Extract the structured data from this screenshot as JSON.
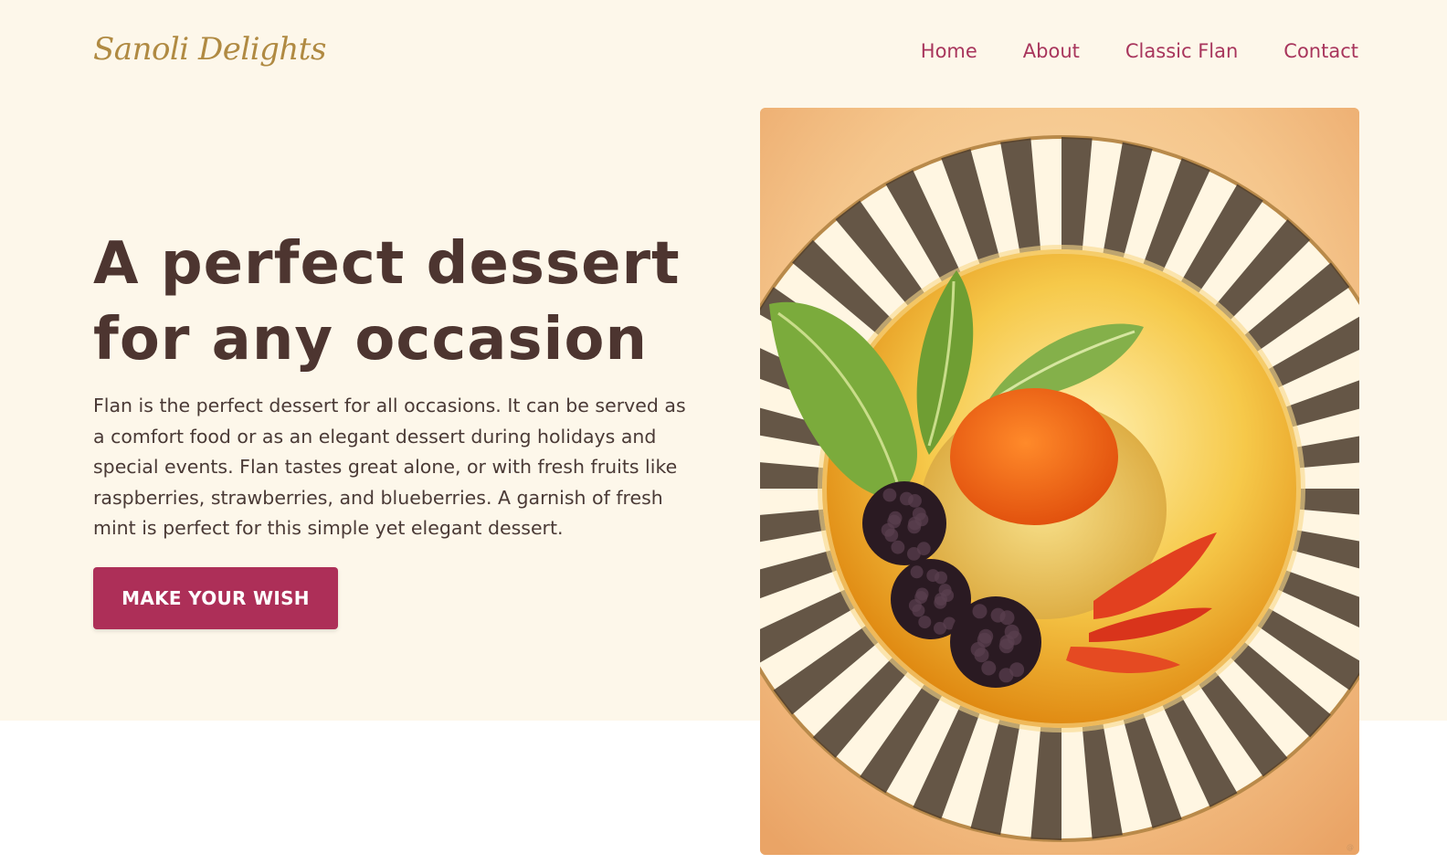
{
  "brand": {
    "logo_text": "Sanoli Delights"
  },
  "nav": {
    "items": [
      "Home",
      "About",
      "Classic Flan",
      "Contact"
    ]
  },
  "hero": {
    "headline_line1": "A perfect dessert",
    "headline_line2": "for any occasion",
    "body": "Flan is the perfect dessert for all occasions. It can be served as a comfort food or as an elegant dessert during holidays and special events. Flan tastes great alone, or with fresh fruits like raspberries, strawberries, and blueberries. A garnish of fresh mint is perfect for this simple yet elegant dessert.",
    "cta_label": "MAKE YOUR WISH"
  },
  "image": {
    "alt": "Caramel flan on a striped plate with blackberries, strawberries and mint"
  },
  "colors": {
    "hero_background": "#fdf7ea",
    "logo": "#b08a42",
    "nav_link": "#a8355c",
    "headline": "#4d3530",
    "cta_background": "#ad2f58"
  }
}
